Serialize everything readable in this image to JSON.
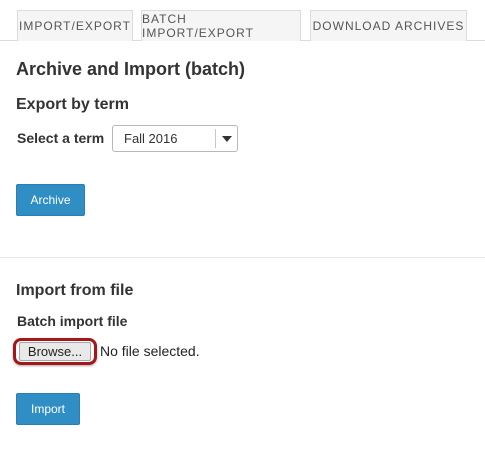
{
  "tabs": [
    {
      "label": "IMPORT/EXPORT"
    },
    {
      "label": "BATCH IMPORT/EXPORT"
    },
    {
      "label": "DOWNLOAD ARCHIVES"
    }
  ],
  "page_title": "Archive and Import (batch)",
  "export_section": {
    "heading": "Export by term",
    "term_label": "Select a term",
    "term_selected": "Fall 2016",
    "archive_button": "Archive"
  },
  "import_section": {
    "heading": "Import from file",
    "file_label": "Batch import file",
    "browse_button": "Browse...",
    "file_status": "No file selected.",
    "import_button": "Import"
  },
  "colors": {
    "primary_button": "#2f8fc4",
    "highlight_ring": "#a3171a"
  }
}
